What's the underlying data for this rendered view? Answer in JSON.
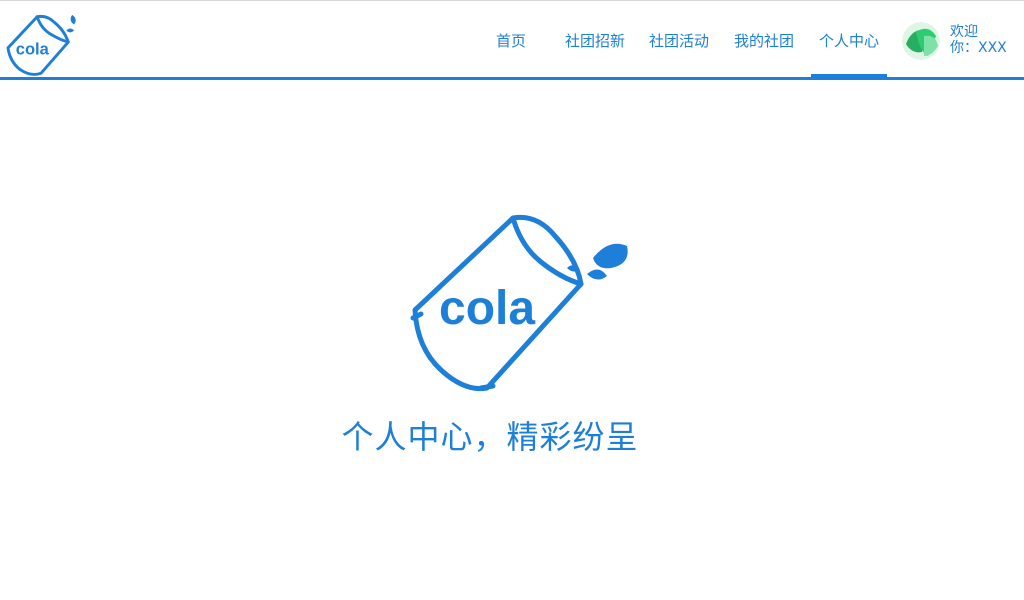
{
  "header": {
    "logo_text": "cola",
    "nav": [
      {
        "label": "首页"
      },
      {
        "label": "社团招新"
      },
      {
        "label": "社团活动"
      },
      {
        "label": "我的社团"
      },
      {
        "label": "个人中心",
        "active": true
      }
    ],
    "welcome_line1": "欢迎",
    "welcome_line2": "你：XXX"
  },
  "hero": {
    "logo_text": "cola",
    "slogan": "个人中心，精彩纷呈"
  },
  "colors": {
    "accent": "#1e7fd8",
    "avatar_green": "#2ecc71"
  }
}
